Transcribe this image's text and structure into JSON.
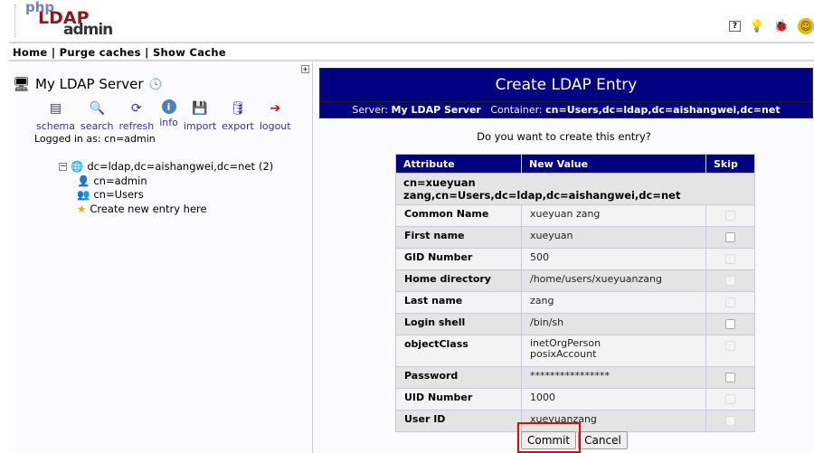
{
  "logo": {
    "php": "php",
    "ldap": "LDAP",
    "admin": "admin"
  },
  "header_icons": [
    "help-icon",
    "lightbulb-icon",
    "bug-icon",
    "smiley-icon"
  ],
  "nav": {
    "items": [
      "Home",
      "Purge caches",
      "Show Cache"
    ],
    "sep": "|"
  },
  "server": {
    "name": "My LDAP Server",
    "tools": [
      {
        "label": "schema",
        "icon": "schema-icon"
      },
      {
        "label": "search",
        "icon": "search-icon"
      },
      {
        "label": "refresh",
        "icon": "refresh-icon"
      },
      {
        "label": "info",
        "icon": "info-icon"
      },
      {
        "label": "import",
        "icon": "import-icon"
      },
      {
        "label": "export",
        "icon": "export-icon"
      },
      {
        "label": "logout",
        "icon": "logout-icon"
      }
    ],
    "logged_in": "Logged in as: cn=admin"
  },
  "tree": {
    "root": "dc=ldap,dc=aishangwei,dc=net",
    "root_count": "(2)",
    "children": [
      "cn=admin",
      "cn=Users"
    ],
    "create": "Create new entry here"
  },
  "panel": {
    "title": "Create LDAP Entry",
    "server_label": "Server:",
    "server": "My LDAP Server",
    "container_label": "Container:",
    "container": "cn=Users,dc=ldap,dc=aishangwei,dc=net",
    "question": "Do you want to create this entry?"
  },
  "table": {
    "headers": [
      "Attribute",
      "New Value",
      "Skip"
    ],
    "dn": "cn=xueyuan zang,cn=Users,dc=ldap,dc=aishangwei,dc=net",
    "rows": [
      {
        "attr": "Common Name",
        "value": "xueyuan zang",
        "skip_enabled": false
      },
      {
        "attr": "First name",
        "value": "xueyuan",
        "skip_enabled": true
      },
      {
        "attr": "GID Number",
        "value": "500",
        "skip_enabled": false
      },
      {
        "attr": "Home directory",
        "value": "/home/users/xueyuanzang",
        "skip_enabled": false
      },
      {
        "attr": "Last name",
        "value": "zang",
        "skip_enabled": false
      },
      {
        "attr": "Login shell",
        "value": "/bin/sh",
        "skip_enabled": true
      },
      {
        "attr": "objectClass",
        "value": "inetOrgPerson\nposixAccount",
        "skip_enabled": false
      },
      {
        "attr": "Password",
        "value": "****************",
        "skip_enabled": true
      },
      {
        "attr": "UID Number",
        "value": "1000",
        "skip_enabled": false
      },
      {
        "attr": "User ID",
        "value": "xueyuanzang",
        "skip_enabled": false
      }
    ]
  },
  "buttons": {
    "commit": "Commit",
    "cancel": "Cancel"
  }
}
